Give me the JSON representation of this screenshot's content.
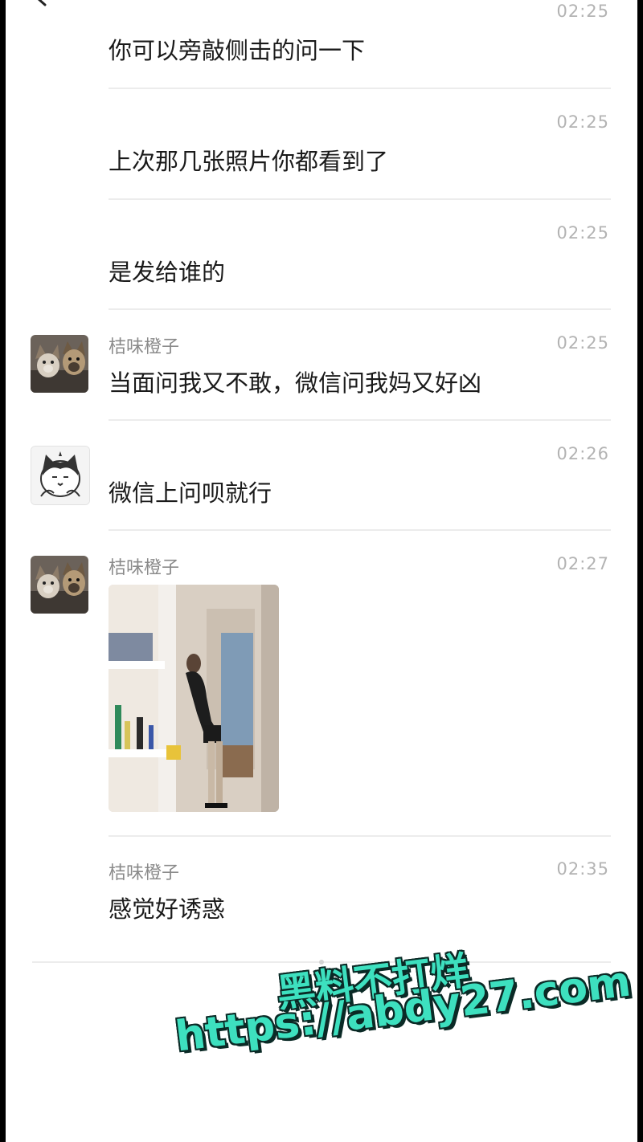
{
  "messages": [
    {
      "time": "02:25",
      "text": "你可以旁敲侧击的问一下"
    },
    {
      "time": "02:25",
      "text": "上次那几张照片你都看到了"
    },
    {
      "time": "02:25",
      "text": "是发给谁的"
    },
    {
      "sender": "桔味橙子",
      "time": "02:25",
      "text": "当面问我又不敢，微信问我妈又好凶",
      "avatar": "dogs-avatar"
    },
    {
      "time": "02:26",
      "text": "微信上问呗就行",
      "avatar": "cat-avatar"
    },
    {
      "sender": "桔味橙子",
      "time": "02:27",
      "image": "photo-message",
      "avatar": "dogs-avatar"
    },
    {
      "sender": "桔味橙子",
      "time": "02:35",
      "text": "感觉好诱惑"
    }
  ],
  "watermark": {
    "line1": "黑料不打烊",
    "line2": "https://abdy27.com",
    "color": "#3de0bf"
  },
  "icons": {
    "back": "back-arrow-icon"
  }
}
